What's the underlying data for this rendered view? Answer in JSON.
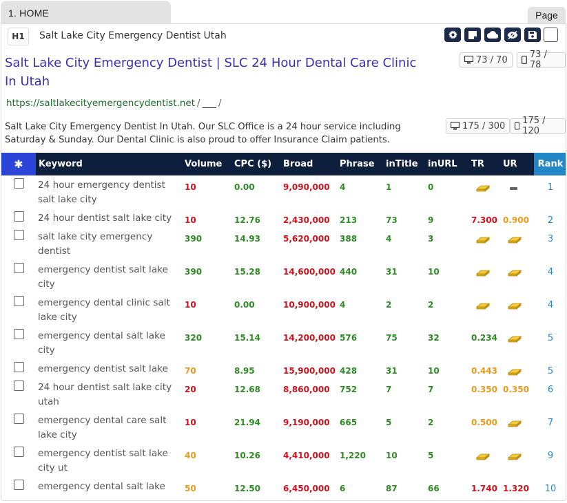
{
  "tab": {
    "label": "1. HOME"
  },
  "page_button": {
    "label": "Page"
  },
  "h1": {
    "tag": "H1",
    "text": "Salt Lake City Emergency Dentist Utah"
  },
  "toolbar": {
    "icons": [
      "gear-icon",
      "note-icon",
      "cloud-icon",
      "eye-slash-icon",
      "save-icon"
    ]
  },
  "page_title": "Salt Lake City Emergency Dentist | SLC 24 Hour Dental Care Clinic In Utah",
  "title_length": {
    "desktop": "73 / 70",
    "mobile": "73 / 78"
  },
  "url": {
    "text": "https://saltlakecityemergencydentist.net",
    "sep1": "/",
    "slug": "___",
    "sep2": "/"
  },
  "description": "Salt Lake City Emergency Dentist In Utah.  Our SLC Office is a 24 hour service including Saturday & Sunday.  Our Dental Clinic is also proud to offer Insurance Claim patients.",
  "description_length": {
    "desktop": "175 / 300",
    "mobile": "175 / 120"
  },
  "table": {
    "headers": {
      "select": "✱",
      "keyword": "Keyword",
      "volume": "Volume",
      "cpc": "CPC ($)",
      "broad": "Broad",
      "phrase": "Phrase",
      "intitle": "inTitle",
      "inurl": "inURL",
      "tr": "TR",
      "ur": "UR",
      "rank": "Rank"
    },
    "rows": [
      {
        "keyword": "24 hour emergency dentist salt lake city",
        "volume": "10",
        "cpc": "0.00",
        "broad": "9,090,000",
        "phrase": "4",
        "intitle": "1",
        "inurl": "0",
        "tr": "",
        "ur": "",
        "rank": "1"
      },
      {
        "keyword": "24 hour dentist salt lake city",
        "volume": "10",
        "cpc": "12.76",
        "broad": "2,430,000",
        "phrase": "213",
        "intitle": "73",
        "inurl": "9",
        "tr": "7.300",
        "ur": "0.900",
        "rank": "2"
      },
      {
        "keyword": "salt lake city emergency dentist",
        "volume": "390",
        "cpc": "14.93",
        "broad": "5,620,000",
        "phrase": "388",
        "intitle": "4",
        "inurl": "3",
        "tr": "",
        "ur": "",
        "rank": "3"
      },
      {
        "keyword": "emergency dentist salt lake city",
        "volume": "390",
        "cpc": "15.28",
        "broad": "14,600,000",
        "phrase": "440",
        "intitle": "31",
        "inurl": "10",
        "tr": "",
        "ur": "",
        "rank": "4"
      },
      {
        "keyword": "emergency dental clinic salt lake city",
        "volume": "10",
        "cpc": "0.00",
        "broad": "10,900,000",
        "phrase": "4",
        "intitle": "2",
        "inurl": "2",
        "tr": "",
        "ur": "",
        "rank": "4"
      },
      {
        "keyword": "emergency dental salt lake city",
        "volume": "320",
        "cpc": "15.14",
        "broad": "14,200,000",
        "phrase": "576",
        "intitle": "75",
        "inurl": "32",
        "tr": "0.234",
        "ur": "",
        "rank": "5"
      },
      {
        "keyword": "emergency dentist salt lake",
        "volume": "70",
        "cpc": "8.95",
        "broad": "15,900,000",
        "phrase": "428",
        "intitle": "31",
        "inurl": "10",
        "tr": "0.443",
        "ur": "",
        "rank": "5"
      },
      {
        "keyword": "24 hour dentist salt lake city utah",
        "volume": "20",
        "cpc": "12.68",
        "broad": "8,860,000",
        "phrase": "752",
        "intitle": "7",
        "inurl": "7",
        "tr": "0.350",
        "ur": "0.350",
        "rank": "6"
      },
      {
        "keyword": "emergency dental care salt lake city",
        "volume": "10",
        "cpc": "21.94",
        "broad": "9,190,000",
        "phrase": "665",
        "intitle": "5",
        "inurl": "2",
        "tr": "0.500",
        "ur": "",
        "rank": "7"
      },
      {
        "keyword": "emergency dentist salt lake city ut",
        "volume": "40",
        "cpc": "10.26",
        "broad": "4,410,000",
        "phrase": "1,220",
        "intitle": "10",
        "inurl": "5",
        "tr": "",
        "ur": "",
        "rank": "9"
      },
      {
        "keyword": "emergency dental salt lake",
        "volume": "50",
        "cpc": "12.50",
        "broad": "6,450,000",
        "phrase": "6",
        "intitle": "87",
        "inurl": "66",
        "tr": "1.740",
        "ur": "1.320",
        "rank": "10"
      }
    ]
  },
  "colors": {
    "header_bg": "#0e1f3e",
    "star_bg": "#2a45d8",
    "rank_bg": "#2386c7",
    "red": "#d0111b",
    "green": "#2e8b24",
    "orange": "#eb9a1e",
    "link": "#3b2fb0"
  }
}
